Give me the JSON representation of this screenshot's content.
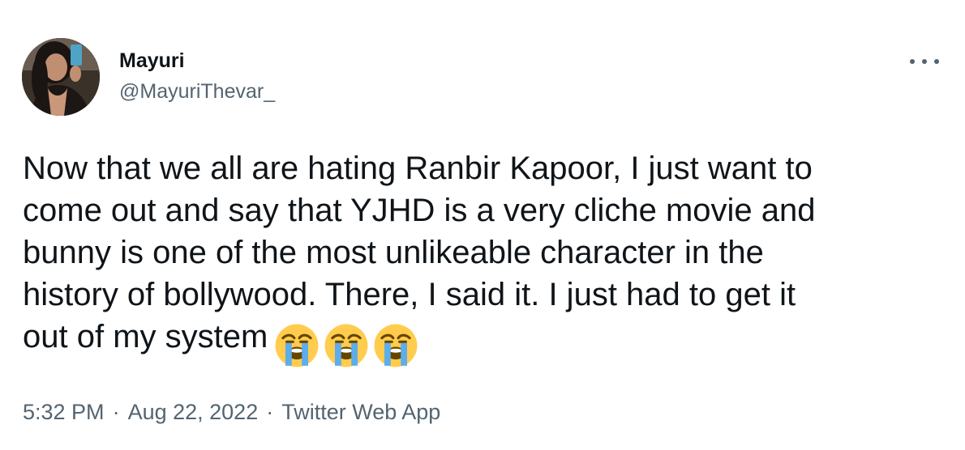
{
  "tweet": {
    "author": {
      "display_name": "Mayuri",
      "handle": "@MayuriThevar_",
      "avatar_icon": "profile-photo"
    },
    "more_icon": "more-horizontal-icon",
    "text_lines": [
      "Now that we all are hating Ranbir Kapoor, I just want to",
      "come out and say that YJHD is a very cliche movie and",
      "bunny is one of the most unlikeable character in the",
      "history of bollywood. There, I said it. I just had to get it",
      "out of my system"
    ],
    "emojis": [
      "😭",
      "😭",
      "😭"
    ],
    "meta": {
      "time": "5:32 PM",
      "separator": "·",
      "date": "Aug 22, 2022",
      "source": "Twitter Web App"
    }
  },
  "colors": {
    "text_primary": "#0f1419",
    "text_secondary": "#536471",
    "background": "#ffffff",
    "emoji_yellow": "#FFCC4D",
    "emoji_tears": "#5DADEC"
  }
}
